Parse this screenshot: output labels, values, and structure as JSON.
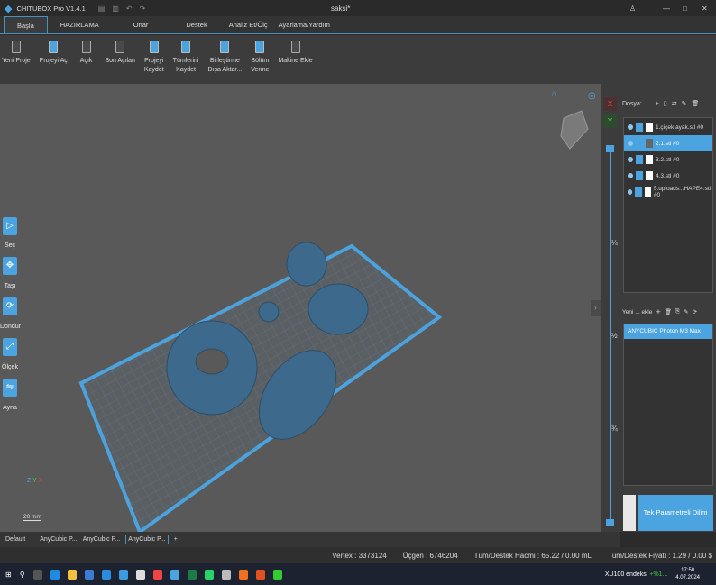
{
  "app": {
    "title": "CHITUBOX Pro V1.4.1",
    "document": "saksi*"
  },
  "tabs": [
    "Başla",
    "HAZIRLAMA",
    "Onar",
    "Destek",
    "Analiz Et/Ölç",
    "Ayarlama/Yardım"
  ],
  "ribbon": [
    {
      "label": "Yeni Proje",
      "icon": "new-project-icon"
    },
    {
      "label": "Projeyi Aç",
      "icon": "open-project-icon"
    },
    {
      "label": "Açık",
      "icon": "open-icon"
    },
    {
      "label": "Son Açılan",
      "icon": "recent-icon"
    },
    {
      "label": "Projeyi\nKaydet",
      "icon": "save-project-icon"
    },
    {
      "label": "Tümlerini\nKaydet",
      "icon": "save-all-icon"
    },
    {
      "label": "Birleştirme\nDışa Aktar...",
      "icon": "merge-export-icon"
    },
    {
      "label": "Bölüm\nVerme",
      "icon": "split-icon"
    },
    {
      "label": "Makine Ekle",
      "icon": "add-machine-icon"
    }
  ],
  "left_tools": [
    "Seç",
    "Taşı",
    "Döndür",
    "Ölçek",
    "Ayna"
  ],
  "scale_label": "20 mm",
  "axis": {
    "x": "X",
    "y": "Y",
    "z": "Z"
  },
  "slider": {
    "x": "X",
    "y": "Y",
    "marks": [
      "¾",
      "½",
      "¼"
    ]
  },
  "files": {
    "label": "Dosya:",
    "items": [
      {
        "name": "1.çiçek ayak.stl #0",
        "selected": false
      },
      {
        "name": "2.1.stl #0",
        "selected": true
      },
      {
        "name": "3.2.stl #0",
        "selected": false
      },
      {
        "name": "4.3.stl #0",
        "selected": false
      },
      {
        "name": "5.uploads...HAPE4.stl #0",
        "selected": false
      }
    ]
  },
  "machines": {
    "label": "Yeni ... ekle",
    "items": [
      "ANYCUBIC Photon M3 Max"
    ]
  },
  "slice_button": "Tek Parametreli Dilim",
  "bottom_tabs": [
    "Default",
    "AnyCubic P...",
    "AnyCubic P...",
    "AnyCubic P..."
  ],
  "status": {
    "vertex": "Vertex : 3373124",
    "triangles": "Üçgen : 6746204",
    "volume": "Tüm/Destek Hacmi : 65.22 / 0.00 mL",
    "price": "Tüm/Destek Fiyatı : 1.29 / 0.00 $"
  },
  "taskbar": {
    "stock": "XU100 endeksi",
    "stock_change": "+%1...",
    "time": "17:50",
    "date": "4.07.2024"
  },
  "colors": {
    "accent": "#4ba3e0",
    "model": "#3d6a8c"
  }
}
